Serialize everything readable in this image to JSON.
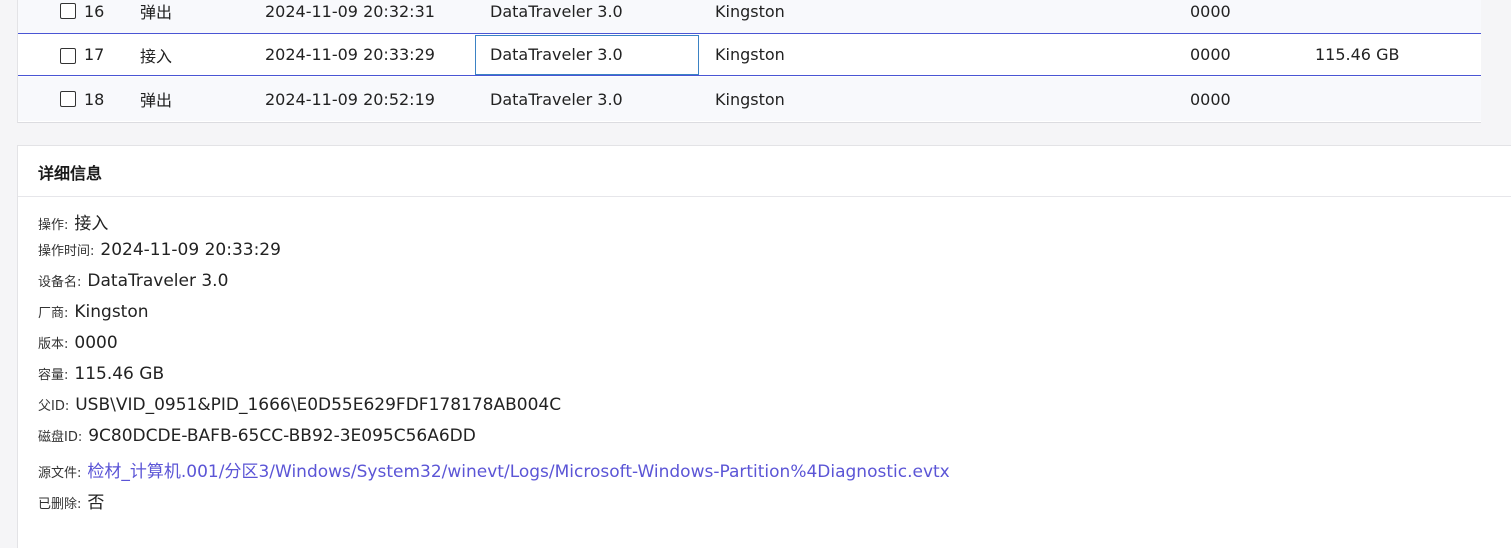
{
  "table": {
    "rows": [
      {
        "num": "16",
        "op": "弹出",
        "time": "2024-11-09 20:32:31",
        "device": "DataTraveler 3.0",
        "vendor": "Kingston",
        "version": "0000",
        "capacity": ""
      },
      {
        "num": "17",
        "op": "接入",
        "time": "2024-11-09 20:33:29",
        "device": "DataTraveler 3.0",
        "vendor": "Kingston",
        "version": "0000",
        "capacity": "115.46 GB"
      },
      {
        "num": "18",
        "op": "弹出",
        "time": "2024-11-09 20:52:19",
        "device": "DataTraveler 3.0",
        "vendor": "Kingston",
        "version": "0000",
        "capacity": ""
      }
    ],
    "selected_row_num": "17"
  },
  "detail": {
    "title": "详细信息",
    "fields": {
      "operation": {
        "label": "操作:",
        "value": "接入"
      },
      "op_time": {
        "label": "操作时间:",
        "value": "2024-11-09 20:33:29"
      },
      "device_name": {
        "label": "设备名:",
        "value": "DataTraveler 3.0"
      },
      "vendor": {
        "label": "厂商:",
        "value": "Kingston"
      },
      "version": {
        "label": "版本:",
        "value": "0000"
      },
      "capacity": {
        "label": "容量:",
        "value": "115.46 GB"
      },
      "parent_id": {
        "label": "父ID:",
        "value": "USB\\VID_0951&PID_1666\\E0D55E629FDF178178AB004C"
      },
      "disk_id": {
        "label": "磁盘ID:",
        "value": "9C80DCDE-BAFB-65CC-BB92-3E095C56A6DD"
      },
      "source_file": {
        "label": "源文件:",
        "value": "检材_计算机.001/分区3/Windows/System32/winevt/Logs/Microsoft-Windows-Partition%4Diagnostic.evtx"
      },
      "deleted": {
        "label": "已删除:",
        "value": "否"
      }
    }
  },
  "colors": {
    "selected_border": "#4a55d4",
    "focus_border": "#3b82c4",
    "link": "#5b55d6"
  }
}
